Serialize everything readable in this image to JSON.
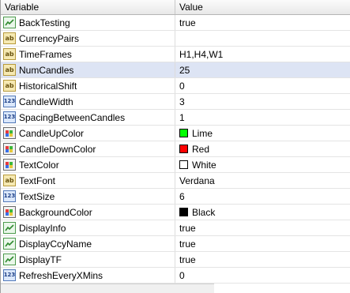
{
  "header": {
    "variable": "Variable",
    "value": "Value"
  },
  "rows": [
    {
      "name": "BackTesting",
      "value": "true",
      "type": "bool"
    },
    {
      "name": "CurrencyPairs",
      "value": "",
      "type": "string"
    },
    {
      "name": "TimeFrames",
      "value": "H1,H4,W1",
      "type": "string"
    },
    {
      "name": "NumCandles",
      "value": "25",
      "type": "string",
      "selected": true
    },
    {
      "name": "HistoricalShift",
      "value": "0",
      "type": "string"
    },
    {
      "name": "CandleWidth",
      "value": "3",
      "type": "int"
    },
    {
      "name": "SpacingBetweenCandles",
      "value": "1",
      "type": "int"
    },
    {
      "name": "CandleUpColor",
      "value": "Lime",
      "type": "color",
      "swatch": "#00ff00"
    },
    {
      "name": "CandleDownColor",
      "value": "Red",
      "type": "color",
      "swatch": "#ff0000"
    },
    {
      "name": "TextColor",
      "value": "White",
      "type": "color",
      "swatch": "#ffffff"
    },
    {
      "name": "TextFont",
      "value": "Verdana",
      "type": "string"
    },
    {
      "name": "TextSize",
      "value": "6",
      "type": "int"
    },
    {
      "name": "BackgroundColor",
      "value": "Black",
      "type": "color",
      "swatch": "#000000"
    },
    {
      "name": "DisplayInfo",
      "value": "true",
      "type": "bool"
    },
    {
      "name": "DisplayCcyName",
      "value": "true",
      "type": "bool"
    },
    {
      "name": "DisplayTF",
      "value": "true",
      "type": "bool"
    },
    {
      "name": "RefreshEveryXMins",
      "value": "0",
      "type": "int"
    }
  ],
  "icons": {
    "string": "string-icon",
    "int": "integer-icon",
    "bool": "boolean-icon",
    "color": "color-icon"
  }
}
